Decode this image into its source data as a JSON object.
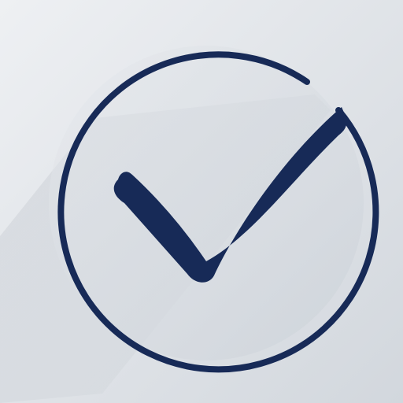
{
  "icon": {
    "name": "check-circle-icon",
    "stroke_color": "#172a57",
    "background_light": "#eceef1",
    "background_dark": "#cfd4da",
    "shadow_color": "#9aa2ac"
  }
}
